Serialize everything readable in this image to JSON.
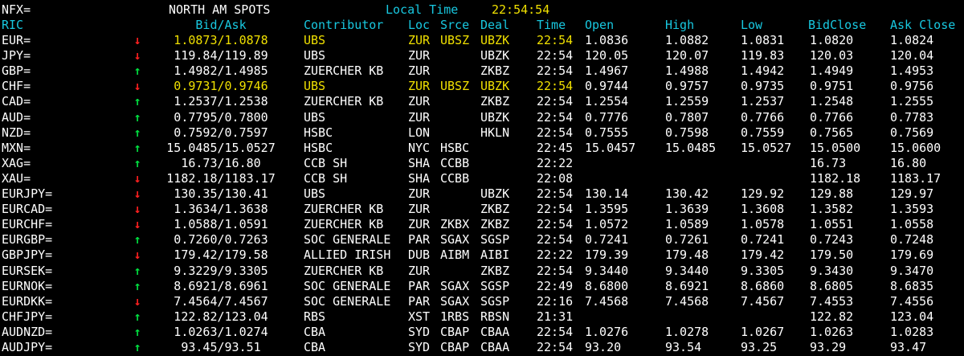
{
  "topline": {
    "page_code": "NFX=",
    "page_title": "NORTH AM SPOTS",
    "time_label": "Local Time",
    "time_value": "22:54:54"
  },
  "headers": {
    "ric": "RIC",
    "bid_ask": "Bid/Ask",
    "contributor": "Contributor",
    "loc": "Loc",
    "srce": "Srce",
    "deal": "Deal",
    "time": "Time",
    "open": "Open",
    "high": "High",
    "low": "Low",
    "bid_close": "BidClose",
    "ask_close": "Ask Close"
  },
  "colors": {
    "header": "#18c8e0",
    "highlight": "#f0e000",
    "up": "#00e040",
    "down": "#ff2020",
    "background": "#000000"
  },
  "rows": [
    {
      "ric": "EUR=",
      "dir": "down",
      "bidask": "1.0873/1.0878",
      "contrib": "UBS",
      "loc": "ZUR",
      "srce": "UBSZ",
      "deal": "UBZK",
      "time": "22:54",
      "open": "1.0836",
      "high": "1.0882",
      "low": "1.0831",
      "bidc": "1.0820",
      "askc": "1.0824",
      "hl": true
    },
    {
      "ric": "JPY=",
      "dir": "down",
      "bidask": "119.84/119.89",
      "contrib": "UBS",
      "loc": "ZUR",
      "srce": "",
      "deal": "UBZK",
      "time": "22:54",
      "open": "120.05",
      "high": "120.07",
      "low": "119.83",
      "bidc": "120.03",
      "askc": "120.04",
      "hl": false
    },
    {
      "ric": "GBP=",
      "dir": "up",
      "bidask": "1.4982/1.4985",
      "contrib": "ZUERCHER KB",
      "loc": "ZUR",
      "srce": "",
      "deal": "ZKBZ",
      "time": "22:54",
      "open": "1.4967",
      "high": "1.4988",
      "low": "1.4942",
      "bidc": "1.4949",
      "askc": "1.4953",
      "hl": false
    },
    {
      "ric": "CHF=",
      "dir": "down",
      "bidask": "0.9731/0.9746",
      "contrib": "UBS",
      "loc": "ZUR",
      "srce": "UBSZ",
      "deal": "UBZK",
      "time": "22:54",
      "open": "0.9744",
      "high": "0.9757",
      "low": "0.9735",
      "bidc": "0.9751",
      "askc": "0.9756",
      "hl": true
    },
    {
      "ric": "CAD=",
      "dir": "up",
      "bidask": "1.2537/1.2538",
      "contrib": "ZUERCHER KB",
      "loc": "ZUR",
      "srce": "",
      "deal": "ZKBZ",
      "time": "22:54",
      "open": "1.2554",
      "high": "1.2559",
      "low": "1.2537",
      "bidc": "1.2548",
      "askc": "1.2555",
      "hl": false
    },
    {
      "ric": "AUD=",
      "dir": "up",
      "bidask": "0.7795/0.7800",
      "contrib": "UBS",
      "loc": "ZUR",
      "srce": "",
      "deal": "UBZK",
      "time": "22:54",
      "open": "0.7776",
      "high": "0.7807",
      "low": "0.7766",
      "bidc": "0.7766",
      "askc": "0.7783",
      "hl": false
    },
    {
      "ric": "NZD=",
      "dir": "up",
      "bidask": "0.7592/0.7597",
      "contrib": "HSBC",
      "loc": "LON",
      "srce": "",
      "deal": "HKLN",
      "time": "22:54",
      "open": "0.7555",
      "high": "0.7598",
      "low": "0.7559",
      "bidc": "0.7565",
      "askc": "0.7569",
      "hl": false
    },
    {
      "ric": "MXN=",
      "dir": "up",
      "bidask": "15.0485/15.0527",
      "contrib": "HSBC",
      "loc": "NYC",
      "srce": "HSBC",
      "deal": "",
      "time": "22:45",
      "open": "15.0457",
      "high": "15.0485",
      "low": "15.0527",
      "bidc": "15.0500",
      "askc": "15.0600",
      "hl": false
    },
    {
      "ric": "XAG=",
      "dir": "up",
      "bidask": "16.73/16.80",
      "contrib": "CCB SH",
      "loc": "SHA",
      "srce": "CCBB",
      "deal": "",
      "time": "22:22",
      "open": "",
      "high": "",
      "low": "",
      "bidc": "16.73",
      "askc": "16.80",
      "hl": false
    },
    {
      "ric": "XAU=",
      "dir": "down",
      "bidask": "1182.18/1183.17",
      "contrib": "CCB SH",
      "loc": "SHA",
      "srce": "CCBB",
      "deal": "",
      "time": "22:08",
      "open": "",
      "high": "",
      "low": "",
      "bidc": "1182.18",
      "askc": "1183.17",
      "hl": false
    },
    {
      "ric": "EURJPY=",
      "dir": "down",
      "bidask": "130.35/130.41",
      "contrib": "UBS",
      "loc": "ZUR",
      "srce": "",
      "deal": "UBZK",
      "time": "22:54",
      "open": "130.14",
      "high": "130.42",
      "low": "129.92",
      "bidc": "129.88",
      "askc": "129.97",
      "hl": false
    },
    {
      "ric": "EURCAD=",
      "dir": "down",
      "bidask": "1.3634/1.3638",
      "contrib": "ZUERCHER KB",
      "loc": "ZUR",
      "srce": "",
      "deal": "ZKBZ",
      "time": "22:54",
      "open": "1.3595",
      "high": "1.3639",
      "low": "1.3608",
      "bidc": "1.3582",
      "askc": "1.3593",
      "hl": false
    },
    {
      "ric": "EURCHF=",
      "dir": "down",
      "bidask": "1.0588/1.0591",
      "contrib": "ZUERCHER KB",
      "loc": "ZUR",
      "srce": "ZKBX",
      "deal": "ZKBZ",
      "time": "22:54",
      "open": "1.0572",
      "high": "1.0589",
      "low": "1.0578",
      "bidc": "1.0551",
      "askc": "1.0558",
      "hl": false
    },
    {
      "ric": "EURGBP=",
      "dir": "up",
      "bidask": "0.7260/0.7263",
      "contrib": "SOC GENERALE",
      "loc": "PAR",
      "srce": "SGAX",
      "deal": "SGSP",
      "time": "22:54",
      "open": "0.7241",
      "high": "0.7261",
      "low": "0.7241",
      "bidc": "0.7243",
      "askc": "0.7248",
      "hl": false
    },
    {
      "ric": "GBPJPY=",
      "dir": "down",
      "bidask": "179.42/179.58",
      "contrib": "ALLIED IRISH",
      "loc": "DUB",
      "srce": "AIBM",
      "deal": "AIBI",
      "time": "22:22",
      "open": "179.39",
      "high": "179.48",
      "low": "179.42",
      "bidc": "179.50",
      "askc": "179.69",
      "hl": false
    },
    {
      "ric": "EURSEK=",
      "dir": "up",
      "bidask": "9.3229/9.3305",
      "contrib": "ZUERCHER KB",
      "loc": "ZUR",
      "srce": "",
      "deal": "ZKBZ",
      "time": "22:54",
      "open": "9.3440",
      "high": "9.3440",
      "low": "9.3305",
      "bidc": "9.3430",
      "askc": "9.3470",
      "hl": false
    },
    {
      "ric": "EURNOK=",
      "dir": "up",
      "bidask": "8.6921/8.6961",
      "contrib": "SOC GENERALE",
      "loc": "PAR",
      "srce": "SGAX",
      "deal": "SGSP",
      "time": "22:49",
      "open": "8.6800",
      "high": "8.6921",
      "low": "8.6860",
      "bidc": "8.6805",
      "askc": "8.6835",
      "hl": false
    },
    {
      "ric": "EURDKK=",
      "dir": "down",
      "bidask": "7.4564/7.4567",
      "contrib": "SOC GENERALE",
      "loc": "PAR",
      "srce": "SGAX",
      "deal": "SGSP",
      "time": "22:16",
      "open": "7.4568",
      "high": "7.4568",
      "low": "7.4567",
      "bidc": "7.4553",
      "askc": "7.4556",
      "hl": false
    },
    {
      "ric": "CHFJPY=",
      "dir": "up",
      "bidask": "122.82/123.04",
      "contrib": "RBS",
      "loc": "XST",
      "srce": "1RBS",
      "deal": "RBSN",
      "time": "21:31",
      "open": "",
      "high": "",
      "low": "",
      "bidc": "122.82",
      "askc": "123.04",
      "hl": false
    },
    {
      "ric": "AUDNZD=",
      "dir": "up",
      "bidask": "1.0263/1.0274",
      "contrib": "CBA",
      "loc": "SYD",
      "srce": "CBAP",
      "deal": "CBAA",
      "time": "22:54",
      "open": "1.0276",
      "high": "1.0278",
      "low": "1.0267",
      "bidc": "1.0263",
      "askc": "1.0283",
      "hl": false
    },
    {
      "ric": "AUDJPY=",
      "dir": "up",
      "bidask": "93.45/93.51",
      "contrib": "CBA",
      "loc": "SYD",
      "srce": "CBAP",
      "deal": "CBAA",
      "time": "22:54",
      "open": "93.20",
      "high": "93.54",
      "low": "93.25",
      "bidc": "93.29",
      "askc": "93.47",
      "hl": false
    }
  ]
}
